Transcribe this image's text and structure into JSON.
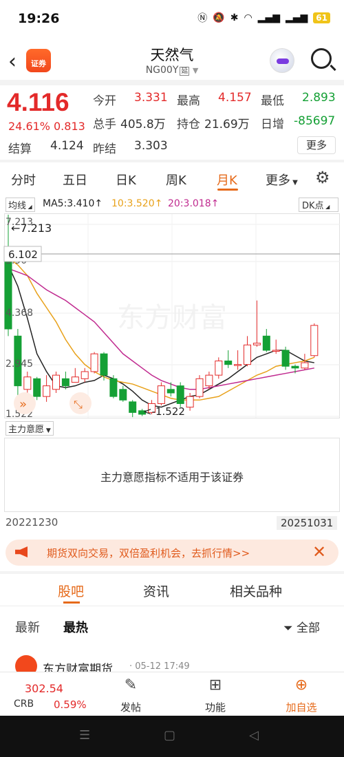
{
  "status": {
    "time": "19:26",
    "battery": "61"
  },
  "header": {
    "logo_text": "证券",
    "title": "天然气",
    "code": "NG00Y",
    "delay_tag": "延"
  },
  "quote": {
    "price": "4.116",
    "change_pct": "24.61%",
    "change_abs": "0.813",
    "open_label": "今开",
    "open": "3.331",
    "high_label": "最高",
    "high": "4.157",
    "low_label": "最低",
    "low": "2.893",
    "volume_label": "总手",
    "volume": "405.8万",
    "position_label": "持仓",
    "position": "21.69万",
    "daily_inc_label": "日增",
    "daily_inc": "-85697",
    "settle_label": "结算",
    "settle": "4.124",
    "prev_settle_label": "昨结",
    "prev_settle": "3.303",
    "more_label": "更多"
  },
  "tabs": [
    "分时",
    "五日",
    "日K",
    "周K",
    "月K",
    "更多"
  ],
  "ma": {
    "line_btn": "均线",
    "ma5": "MA5:3.410↑",
    "ma10": "10:3.520↑",
    "ma20": "20:3.018↑",
    "dk_btn": "DK点",
    "colors": {
      "ma5": "#222222",
      "ma10": "#e8a11a",
      "ma20": "#c02a8f"
    }
  },
  "chart_data": {
    "type": "candlestick",
    "price_labels": {
      "top": "7.213",
      "mid_high": "5.90",
      "mid": "4.368",
      "mid_low": "2.945",
      "bottom": "1.522"
    },
    "hover_price": "6.102",
    "max_annotation": "←7.213",
    "min_annotation": "<-1.522",
    "ylim": [
      1.522,
      7.213
    ],
    "candles": [
      {
        "o": 6.2,
        "c": 4.0,
        "h": 7.213,
        "l": 3.8
      },
      {
        "o": 3.8,
        "c": 2.4,
        "h": 4.0,
        "l": 2.1
      },
      {
        "o": 2.3,
        "c": 2.65,
        "h": 2.8,
        "l": 2.2
      },
      {
        "o": 2.6,
        "c": 2.1,
        "h": 2.65,
        "l": 2.0
      },
      {
        "o": 2.1,
        "c": 2.4,
        "h": 2.7,
        "l": 1.95
      },
      {
        "o": 2.3,
        "c": 2.7,
        "h": 2.8,
        "l": 2.2
      },
      {
        "o": 2.6,
        "c": 2.4,
        "h": 2.8,
        "l": 2.3
      },
      {
        "o": 2.5,
        "c": 2.65,
        "h": 2.9,
        "l": 2.5
      },
      {
        "o": 2.6,
        "c": 2.8,
        "h": 2.9,
        "l": 2.5
      },
      {
        "o": 2.8,
        "c": 3.3,
        "h": 3.35,
        "l": 2.75
      },
      {
        "o": 3.3,
        "c": 2.7,
        "h": 3.35,
        "l": 2.55
      },
      {
        "o": 2.6,
        "c": 2.1,
        "h": 2.7,
        "l": 2.05
      },
      {
        "o": 2.3,
        "c": 2.0,
        "h": 2.4,
        "l": 1.95
      },
      {
        "o": 1.95,
        "c": 1.65,
        "h": 2.0,
        "l": 1.52
      },
      {
        "o": 1.7,
        "c": 1.6,
        "h": 1.75,
        "l": 1.55
      },
      {
        "o": 1.65,
        "c": 1.9,
        "h": 2.0,
        "l": 1.6
      },
      {
        "o": 1.9,
        "c": 2.4,
        "h": 2.5,
        "l": 1.85
      },
      {
        "o": 2.3,
        "c": 2.2,
        "h": 2.5,
        "l": 2.1
      },
      {
        "o": 2.4,
        "c": 1.9,
        "h": 2.5,
        "l": 1.8
      },
      {
        "o": 1.8,
        "c": 2.1,
        "h": 2.2,
        "l": 1.7
      },
      {
        "o": 2.1,
        "c": 2.6,
        "h": 2.7,
        "l": 2.05
      },
      {
        "o": 2.4,
        "c": 2.7,
        "h": 2.8,
        "l": 2.3
      },
      {
        "o": 2.7,
        "c": 3.1,
        "h": 3.2,
        "l": 2.6
      },
      {
        "o": 3.1,
        "c": 3.0,
        "h": 3.4,
        "l": 2.9
      },
      {
        "o": 3.0,
        "c": 3.0,
        "h": 3.4,
        "l": 2.85
      },
      {
        "o": 3.0,
        "c": 3.55,
        "h": 3.8,
        "l": 2.95
      },
      {
        "o": 3.55,
        "c": 3.6,
        "h": 4.8,
        "l": 3.5
      },
      {
        "o": 3.8,
        "c": 3.4,
        "h": 4.0,
        "l": 3.35
      },
      {
        "o": 3.4,
        "c": 3.4,
        "h": 3.7,
        "l": 3.3
      },
      {
        "o": 3.4,
        "c": 2.95,
        "h": 3.5,
        "l": 2.85
      },
      {
        "o": 2.95,
        "c": 2.9,
        "h": 3.0,
        "l": 2.75
      },
      {
        "o": 2.9,
        "c": 3.05,
        "h": 3.3,
        "l": 2.85
      },
      {
        "o": 3.25,
        "c": 4.1,
        "h": 4.157,
        "l": 3.2
      }
    ],
    "ma5": [
      5.8,
      5.2,
      4.3,
      3.3,
      2.8,
      2.4,
      2.35,
      2.4,
      2.5,
      2.55,
      2.7,
      2.6,
      2.45,
      2.25,
      2.0,
      1.85,
      1.8,
      1.9,
      2.0,
      2.1,
      2.15,
      2.3,
      2.45,
      2.6,
      2.8,
      3.0,
      3.2,
      3.3,
      3.4,
      3.4,
      3.25,
      3.1,
      3.05
    ],
    "ma10": [
      6.0,
      5.8,
      5.5,
      5.0,
      4.6,
      4.2,
      3.7,
      3.3,
      3.0,
      2.8,
      2.65,
      2.55,
      2.5,
      2.45,
      2.35,
      2.25,
      2.15,
      2.05,
      2.0,
      2.0,
      2.0,
      2.05,
      2.1,
      2.25,
      2.4,
      2.55,
      2.7,
      2.8,
      2.95,
      3.0,
      3.05,
      3.1,
      3.2
    ],
    "ma20": [
      5.7,
      5.6,
      5.5,
      5.3,
      5.1,
      4.95,
      4.8,
      4.6,
      4.4,
      4.2,
      3.9,
      3.6,
      3.3,
      3.1,
      2.9,
      2.7,
      2.55,
      2.45,
      2.35,
      2.3,
      2.3,
      2.35,
      2.4,
      2.45,
      2.5,
      2.55,
      2.6,
      2.65,
      2.7,
      2.75,
      2.8,
      2.85,
      2.9
    ]
  },
  "indicator": {
    "label": "主力意愿",
    "message": "主力意愿指标不适用于该证券"
  },
  "dates": {
    "start": "20221230",
    "end": "20251031"
  },
  "banner": {
    "text": "期货双向交易，双倍盈利机会，去抓行情>>"
  },
  "social_tabs": [
    "股吧",
    "资讯",
    "相关品种"
  ],
  "sort_tabs": [
    "最新",
    "最热"
  ],
  "filter_label": "全部",
  "post": {
    "author": "东方财富期货",
    "time": "· 05-12 17:49"
  },
  "toolbar": {
    "index_price": "302.54",
    "index_code": "CRB",
    "index_pct": "0.59%",
    "post_label": "发帖",
    "func_label": "功能",
    "fav_label": "加自选"
  },
  "watermark": "东方财富"
}
